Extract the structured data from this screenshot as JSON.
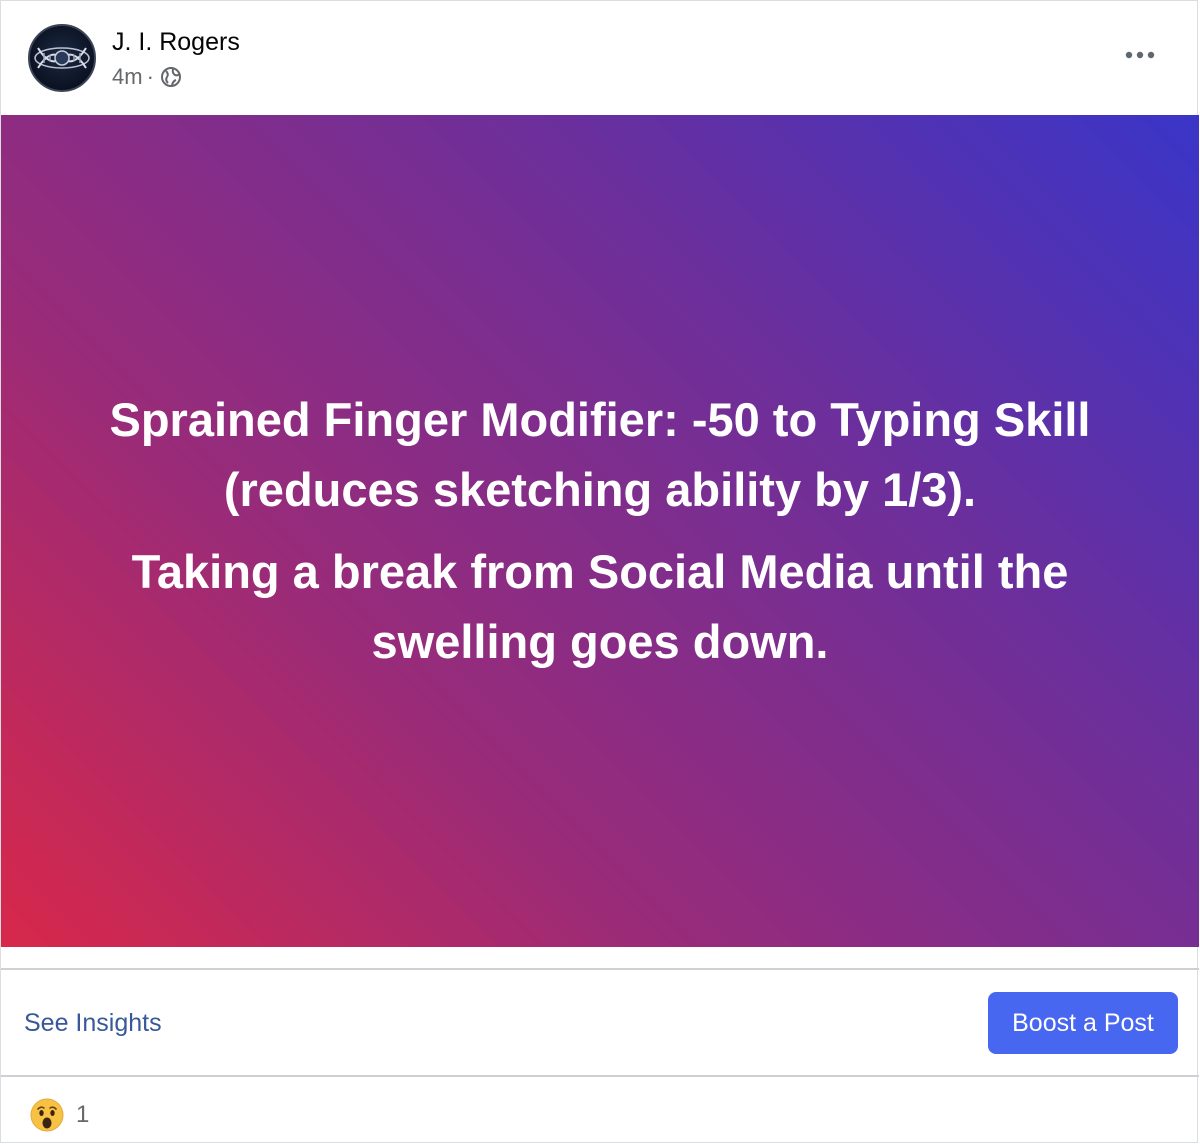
{
  "header": {
    "author_name": "J. I. Rogers",
    "timestamp": "4m",
    "separator": "·",
    "privacy_icon": "globe-icon",
    "more_icon": "more-options-icon"
  },
  "post": {
    "text_lines": [
      "Sprained Finger Modifier: -50 to Typing Skill (reduces sketching ability by 1/3).",
      "Taking a break from Social Media until the swelling goes down."
    ],
    "background_colors": [
      "#3a35c8",
      "#6b2f9c",
      "#9a2b78",
      "#d8284a"
    ]
  },
  "actions": {
    "insights_label": "See Insights",
    "boost_label": "Boost a Post",
    "boost_color": "#4867f0",
    "insights_color": "#385898"
  },
  "reactions": {
    "icon": "wow-reaction-icon",
    "count": "1"
  }
}
